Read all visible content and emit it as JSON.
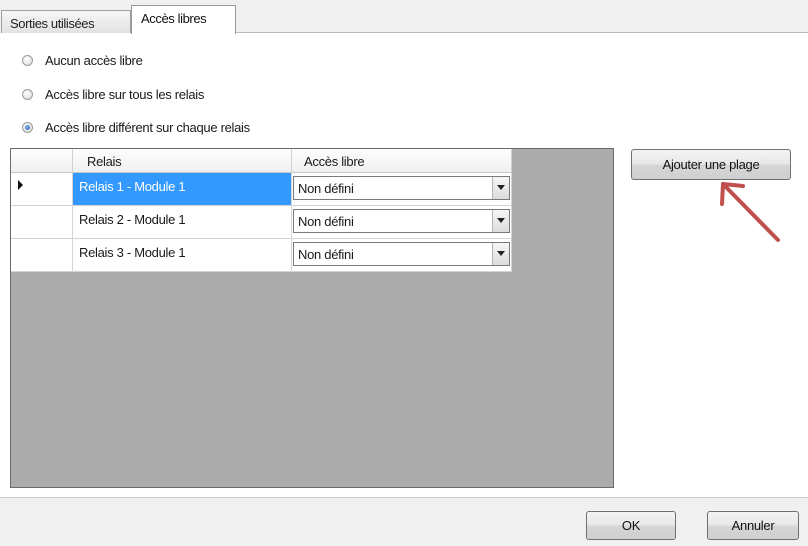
{
  "tabs": [
    {
      "label": "Sorties utilisées",
      "active": false
    },
    {
      "label": "Accès libres",
      "active": true
    }
  ],
  "radio_options": [
    {
      "label": "Aucun accès libre",
      "checked": false
    },
    {
      "label": "Accès libre sur tous les relais",
      "checked": false
    },
    {
      "label": "Accès libre différent sur chaque relais",
      "checked": true
    }
  ],
  "grid": {
    "columns": [
      "Relais",
      "Accès libre"
    ],
    "rows": [
      {
        "relais": "Relais 1 - Module 1",
        "acces": "Non défini",
        "selected": true
      },
      {
        "relais": "Relais 2 - Module 1",
        "acces": "Non défini",
        "selected": false
      },
      {
        "relais": "Relais 3 - Module 1",
        "acces": "Non défini",
        "selected": false
      }
    ]
  },
  "add_range_button": "Ajouter une plage",
  "footer": {
    "ok": "OK",
    "cancel": "Annuler"
  },
  "colors": {
    "selection": "#3399ff",
    "grid_background": "#ababab",
    "annotation_arrow": "#c0504d"
  },
  "icons": {
    "row_indicator": "triangle-right-icon",
    "dropdown": "chevron-down-icon"
  }
}
